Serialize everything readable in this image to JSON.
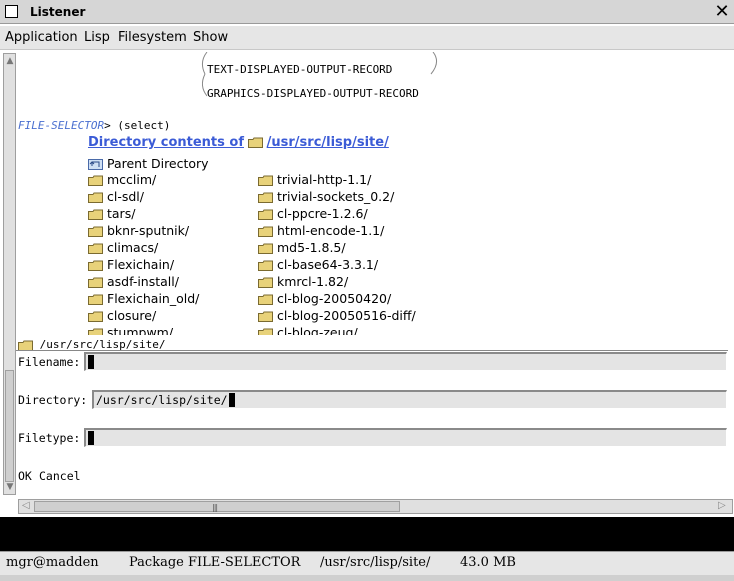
{
  "window": {
    "title": "Listener",
    "close_glyph": "✕"
  },
  "menu": {
    "items": [
      "Application",
      "Lisp",
      "Filesystem",
      "Show"
    ]
  },
  "graph": {
    "nodes": [
      "TEXT-DISPLAYED-OUTPUT-RECORD",
      "GRAPHICS-DISPLAYED-OUTPUT-RECORD"
    ]
  },
  "prompt": {
    "package": "FILE-SELECTOR",
    "text": "> (select)"
  },
  "listing": {
    "heading": "Directory contents of",
    "path": "/usr/src/lisp/site/",
    "parent_label": "Parent Directory",
    "col1": [
      "mcclim/",
      "cl-sdl/",
      "tars/",
      "bknr-sputnik/",
      "climacs/",
      "Flexichain/",
      "asdf-install/",
      "Flexichain_old/",
      "closure/",
      "stumpwm/"
    ],
    "col2": [
      "trivial-http-1.1/",
      "trivial-sockets_0.2/",
      "cl-ppcre-1.2.6/",
      "html-encode-1.1/",
      "md5-1.8.5/",
      "cl-base64-3.3.1/",
      "kmrcl-1.82/",
      "cl-blog-20050420/",
      "cl-blog-20050516-diff/",
      "cl-blog-zeug/"
    ]
  },
  "current_dir": "/usr/src/lisp/site/",
  "form": {
    "filename_label": "Filename:",
    "filename_value": "",
    "directory_label": "Directory:",
    "directory_value": "/usr/src/lisp/site/",
    "filetype_label": "Filetype:",
    "filetype_value": "",
    "ok_label": "OK",
    "cancel_label": "Cancel"
  },
  "status": {
    "user": "mgr@madden",
    "package": "Package FILE-SELECTOR",
    "directory": "/usr/src/lisp/site/",
    "memory": "43.0 MB"
  },
  "colors": {
    "link": "#3b5bd6",
    "prompt": "#4a6fd0",
    "folder": "#e8d27a"
  }
}
